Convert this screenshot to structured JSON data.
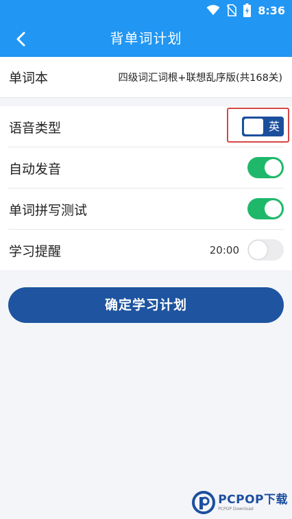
{
  "status_bar": {
    "time": "8:36",
    "icons": [
      "wifi-icon",
      "no-sim-icon",
      "battery-charging-icon"
    ]
  },
  "header": {
    "title": "背单词计划",
    "back_icon": "chevron-left-icon"
  },
  "wordbook": {
    "label": "单词本",
    "value": "四级词汇词根+联想乱序版(共168关)"
  },
  "settings": {
    "voice_type": {
      "label": "语音类型",
      "value": "英"
    },
    "auto_pronounce": {
      "label": "自动发音",
      "on": true
    },
    "spelling_test": {
      "label": "单词拼写测试",
      "on": true
    },
    "reminder": {
      "label": "学习提醒",
      "time": "20:00",
      "on": false
    }
  },
  "confirm_button": "确定学习计划",
  "watermark": {
    "brand": "PCPOP下载",
    "sub": "PCPOP Download"
  },
  "colors": {
    "primary": "#2196f3",
    "toggle_on": "#1fb86a",
    "button": "#1e54a0",
    "highlight": "#d64545"
  }
}
